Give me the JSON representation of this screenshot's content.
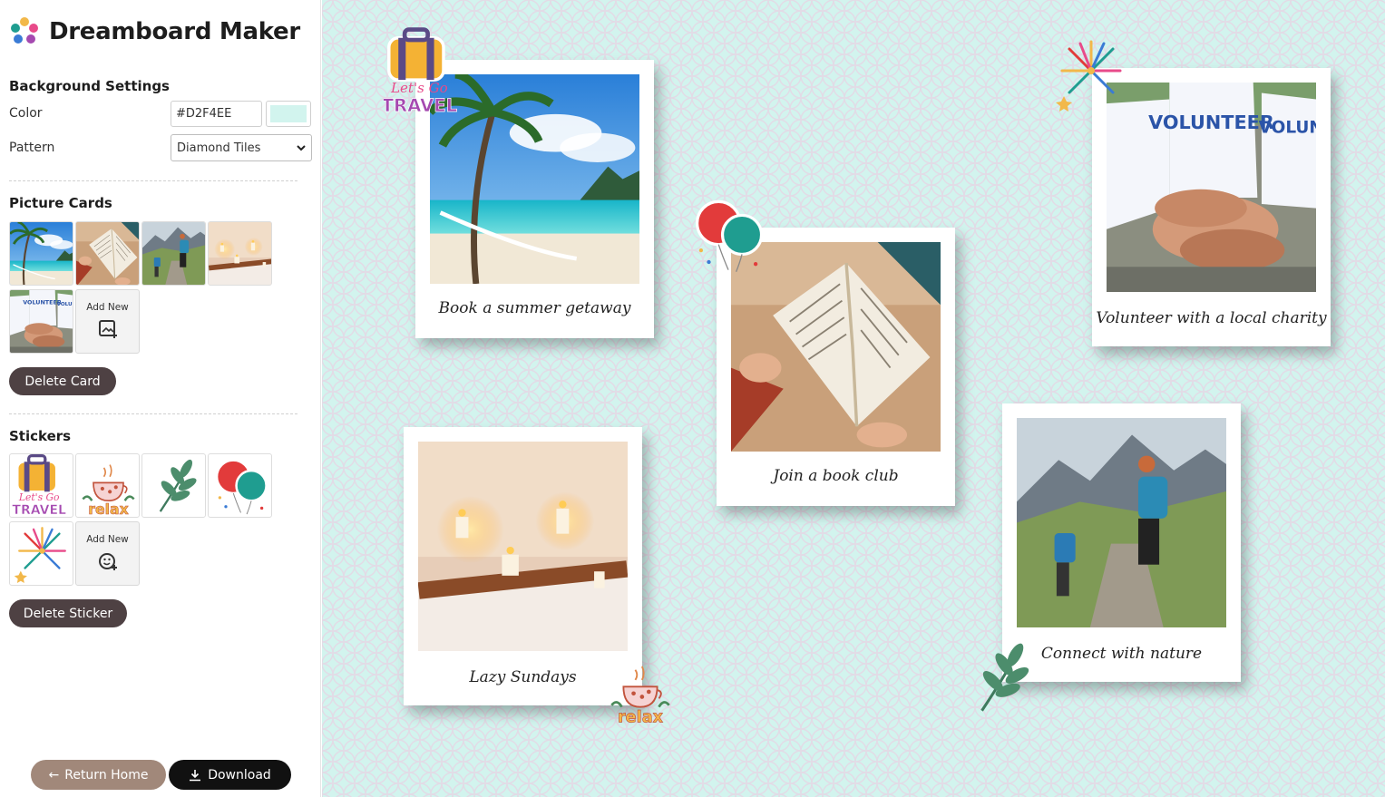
{
  "app": {
    "title": "Dreamboard Maker"
  },
  "background": {
    "heading": "Background Settings",
    "color_label": "Color",
    "color_value": "#D2F4EE",
    "pattern_label": "Pattern",
    "pattern_value": "Diamond Tiles"
  },
  "picture_cards": {
    "heading": "Picture Cards",
    "thumbnails": [
      "beach",
      "book",
      "hikers",
      "candles",
      "volunteers"
    ],
    "add_new_label": "Add New",
    "delete_label": "Delete Card"
  },
  "stickers": {
    "heading": "Stickers",
    "items": [
      "travel",
      "relax",
      "leaf",
      "balloons",
      "fireworks"
    ],
    "add_new_label": "Add New",
    "delete_label": "Delete Sticker"
  },
  "footer": {
    "home_label": "Return Home",
    "download_label": "Download"
  },
  "board": {
    "cards": [
      {
        "caption": "Book a summer getaway",
        "photo": "beach"
      },
      {
        "caption": "Join a book club",
        "photo": "book"
      },
      {
        "caption": "Volunteer with a local charity",
        "photo": "volunteers"
      },
      {
        "caption": "Lazy Sundays",
        "photo": "candles"
      },
      {
        "caption": "Connect with nature",
        "photo": "hikers"
      }
    ],
    "stickers": [
      {
        "name": "travel",
        "text1": "Let's Go",
        "text2": "TRAVEL"
      },
      {
        "name": "balloons"
      },
      {
        "name": "fireworks"
      },
      {
        "name": "relax",
        "text": "relax"
      },
      {
        "name": "leaf"
      }
    ]
  },
  "colors": {
    "accent": "#4e4143",
    "home_button": "#a1887a",
    "canvas": "#D2F4EE"
  }
}
